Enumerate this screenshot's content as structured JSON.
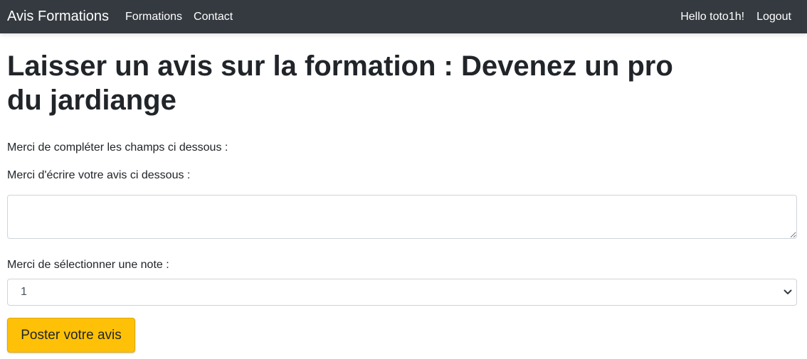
{
  "navbar": {
    "brand": "Avis Formations",
    "links": [
      "Formations",
      "Contact"
    ],
    "greeting": "Hello toto1h!",
    "logout": "Logout",
    "bg_color": "#343a40"
  },
  "page": {
    "title": "Laisser un avis sur la formation : Devenez un pro du jardiange",
    "intro": "Merci de compléter les champs ci dessous :",
    "review_label": "Merci d'écrire votre avis ci dessous :",
    "review_value": "",
    "rating_label": "Merci de sélectionner une note :",
    "rating_value": "1",
    "submit": "Poster votre avis",
    "submit_color": "#ffc107"
  }
}
